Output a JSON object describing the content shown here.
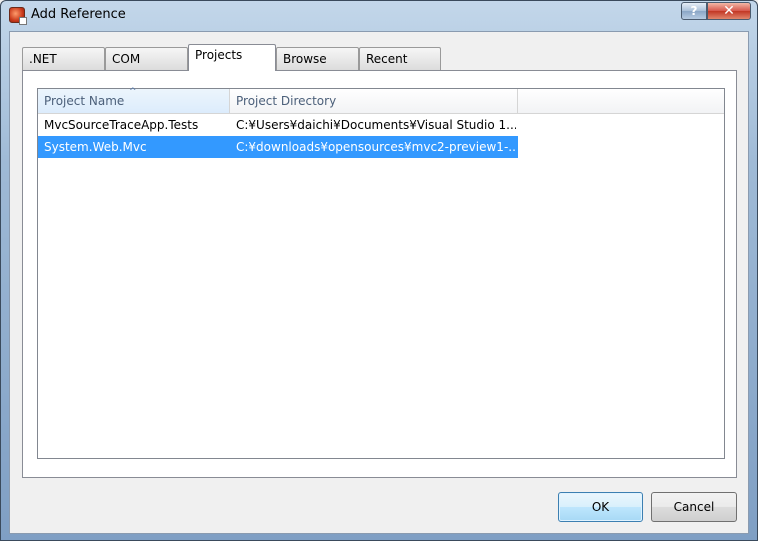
{
  "window": {
    "title": "Add Reference",
    "help_glyph": "?",
    "close_glyph": "✕"
  },
  "tabs": [
    {
      "label": ".NET",
      "active": false
    },
    {
      "label": "COM",
      "active": false
    },
    {
      "label": "Projects",
      "active": true
    },
    {
      "label": "Browse",
      "active": false
    },
    {
      "label": "Recent",
      "active": false
    }
  ],
  "list": {
    "columns": [
      {
        "label": "Project Name",
        "sorted": "ascending"
      },
      {
        "label": "Project Directory"
      }
    ],
    "rows": [
      {
        "name": "MvcSourceTraceApp.Tests",
        "directory": "C:¥Users¥daichi¥Documents¥Visual Studio 1...",
        "selected": false
      },
      {
        "name": "System.Web.Mvc",
        "directory": "C:¥downloads¥opensources¥mvc2-preview1-...",
        "selected": true
      }
    ]
  },
  "buttons": {
    "ok": "OK",
    "cancel": "Cancel"
  },
  "colors": {
    "selection": "#3399ff",
    "close_button": "#c23624"
  }
}
